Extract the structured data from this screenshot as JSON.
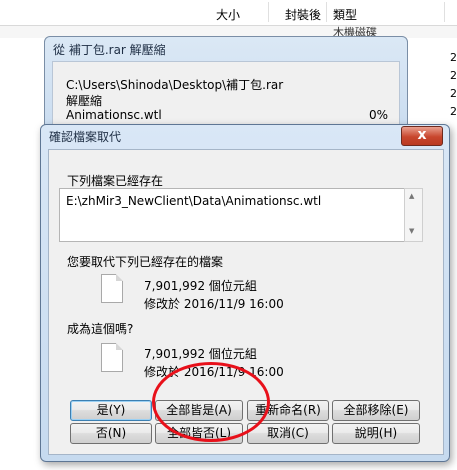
{
  "explorer": {
    "columns": [
      "大小",
      "封裝後",
      "類型"
    ],
    "partial_type": "木機磁碟",
    "right_digits": [
      "2",
      "2",
      "2",
      "2"
    ]
  },
  "progress_dialog": {
    "title": "從 補丁包.rar 解壓縮",
    "archive_path": "C:\\Users\\Shinoda\\Desktop\\補丁包.rar",
    "action": "解壓縮",
    "current_file": "Animationsc.wtl",
    "percent": "0%"
  },
  "confirm_dialog": {
    "title": "確認檔案取代",
    "close_label": "x",
    "exists_label": "下列檔案已經存在",
    "existing_path": "E:\\zhMir3_NewClient\\Data\\Animationsc.wtl",
    "replace_question": "您要取代下列已經存在的檔案",
    "existing_file": {
      "size": "7,901,992 個位元組",
      "modified": "修改於 2016/11/9 16:00"
    },
    "with_question": "成為這個嗎?",
    "new_file": {
      "size": "7,901,992 個位元組",
      "modified": "修改於 2016/11/9 16:00"
    },
    "buttons": {
      "yes": "是(Y)",
      "yes_all": "全部皆是(A)",
      "rename": "重新命名(R)",
      "move_all": "全部移除(E)",
      "no": "否(N)",
      "no_all": "全部皆否(L)",
      "cancel": "取消(C)",
      "help": "說明(H)"
    }
  }
}
